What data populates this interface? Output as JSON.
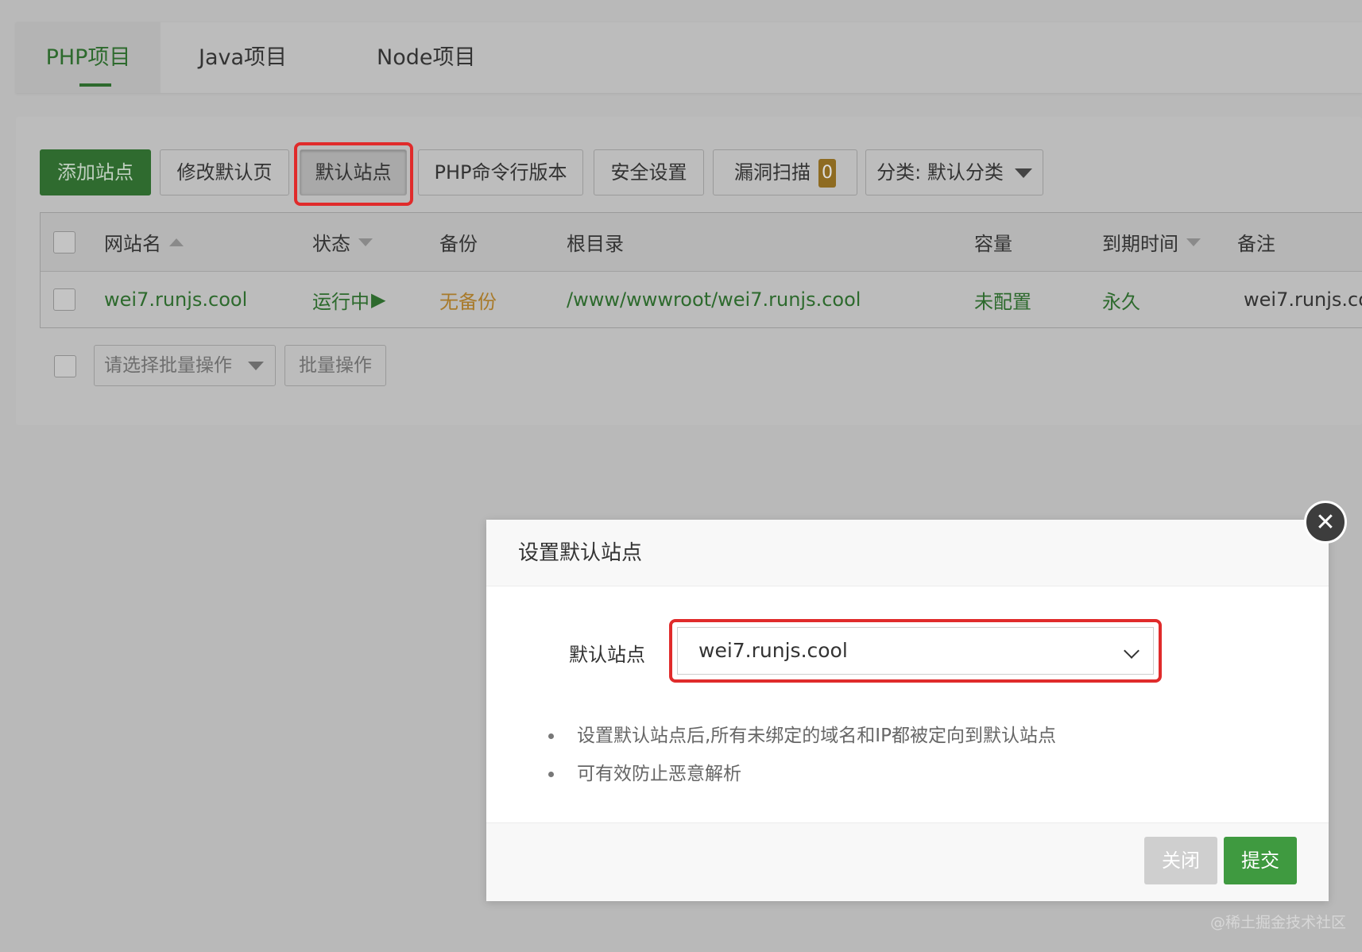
{
  "tabs": [
    {
      "label": "PHP项目",
      "active": true
    },
    {
      "label": "Java项目",
      "active": false
    },
    {
      "label": "Node项目",
      "active": false
    }
  ],
  "toolbar": {
    "add_site": "添加站点",
    "edit_default_page": "修改默认页",
    "default_site": "默认站点",
    "php_cli_version": "PHP命令行版本",
    "security_settings": "安全设置",
    "vuln_scan": "漏洞扫描",
    "vuln_count": "0",
    "category": "分类: 默认分类"
  },
  "table": {
    "headers": {
      "site_name": "网站名",
      "status": "状态",
      "backup": "备份",
      "root_dir": "根目录",
      "capacity": "容量",
      "expire": "到期时间",
      "remark": "备注"
    },
    "rows": [
      {
        "site_name": "wei7.runjs.cool",
        "status": "运行中",
        "backup": "无备份",
        "root_dir": "/www/wwwroot/wei7.runjs.cool",
        "capacity": "未配置",
        "expire": "永久",
        "remark": "wei7.runjs.co"
      }
    ]
  },
  "batch": {
    "select_placeholder": "请选择批量操作",
    "button": "批量操作"
  },
  "modal": {
    "title": "设置默认站点",
    "field_label": "默认站点",
    "selected_value": "wei7.runjs.cool",
    "tips": [
      "设置默认站点后,所有未绑定的域名和IP都被定向到默认站点",
      "可有效防止恶意解析"
    ],
    "close_label": "关闭",
    "submit_label": "提交"
  },
  "watermark": "@稀土掘金技术社区",
  "colors": {
    "accent_green": "#2d6a2d",
    "submit_green": "#3f9a40",
    "highlight_red": "#e02b2b"
  }
}
